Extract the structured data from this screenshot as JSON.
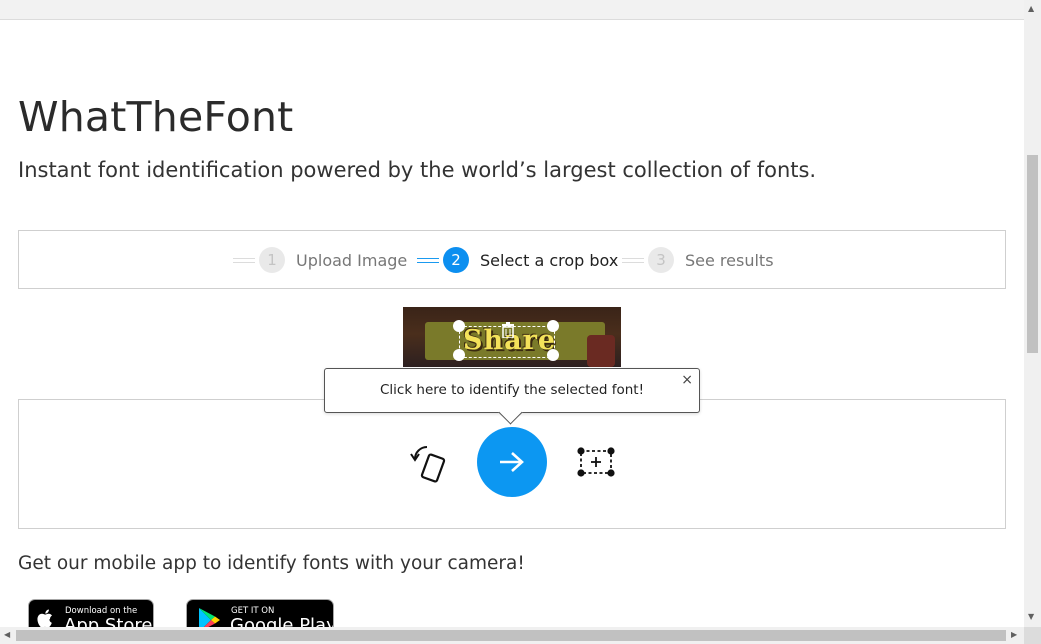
{
  "header": {
    "title": "WhatTheFont",
    "subtitle": "Instant font identification powered by the world’s largest collection of fonts."
  },
  "steps": [
    {
      "number": "1",
      "label": "Upload Image",
      "state": "done"
    },
    {
      "number": "2",
      "label": "Select a crop box",
      "state": "active"
    },
    {
      "number": "3",
      "label": "See results",
      "state": "pending"
    }
  ],
  "preview": {
    "image_text": "Share"
  },
  "tooltip": {
    "text": "Click here to identify the selected font!",
    "close": "×"
  },
  "actions": {
    "rotate_icon": "rotate-icon",
    "submit_icon": "arrow-right-icon",
    "add_crop_icon": "add-crop-box-icon"
  },
  "app_promo": {
    "text": "Get our mobile app to identify fonts with your camera!"
  },
  "badges": {
    "appstore_small": "Download on the",
    "appstore_big": "App Store",
    "googleplay_small": "GET IT ON",
    "googleplay_big": "Google Play"
  },
  "colors": {
    "accent": "#0c97f2",
    "step_active": "#0c8ff0"
  }
}
